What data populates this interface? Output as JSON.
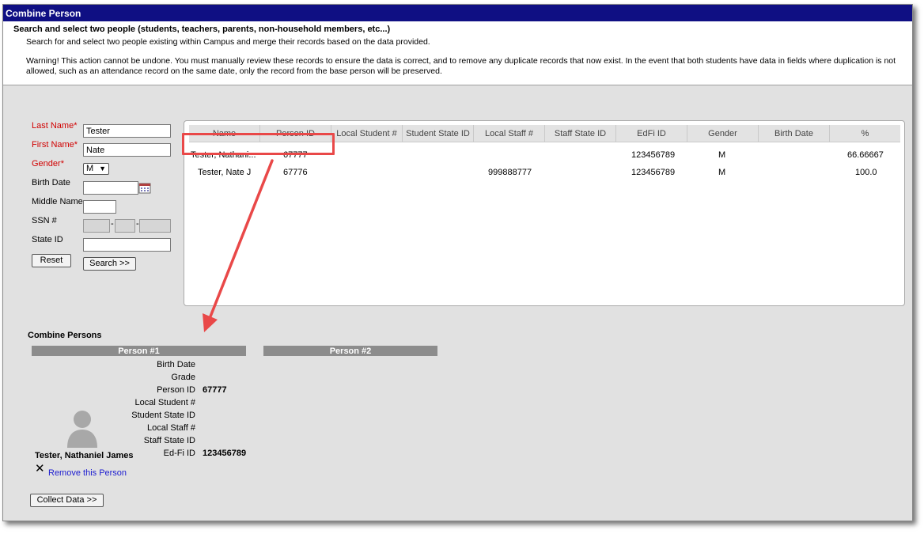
{
  "window": {
    "title": "Combine Person"
  },
  "header": {
    "title": "Search and select two people (students, teachers, parents, non-household members, etc...)",
    "description": "Search for and select two people existing within Campus and merge their records based on the data provided.",
    "warning": "Warning! This action cannot be undone. You must manually review these records to ensure the data is correct, and to remove any duplicate records that now exist. In the event that both students have data in fields where duplication is not allowed, such as an attendance record on the same date, only the record from the base person will be preserved."
  },
  "search": {
    "last_name_label": "Last Name*",
    "last_name_value": "Tester",
    "first_name_label": "First Name*",
    "first_name_value": "Nate",
    "gender_label": "Gender*",
    "gender_value": "M",
    "birth_date_label": "Birth Date",
    "middle_name_label": "Middle Name",
    "ssn_label": "SSN #",
    "ssn_sep": "-",
    "state_id_label": "State ID",
    "reset_label": "Reset",
    "search_label": "Search >>"
  },
  "results": {
    "columns": [
      "Name",
      "Person ID",
      "Local Student #",
      "Student State ID",
      "Local Staff #",
      "Staff State ID",
      "EdFi ID",
      "Gender",
      "Birth Date",
      "%"
    ],
    "rows": [
      {
        "name": "Tester, Nathani...",
        "person_id": "67777",
        "local_student": "",
        "student_state_id": "",
        "local_staff": "",
        "staff_state_id": "",
        "edfi_id": "123456789",
        "gender": "M",
        "birth_date": "",
        "pct": "66.66667"
      },
      {
        "name": "Tester, Nate J",
        "person_id": "67776",
        "local_student": "",
        "student_state_id": "",
        "local_staff": "999888777",
        "staff_state_id": "",
        "edfi_id": "123456789",
        "gender": "M",
        "birth_date": "",
        "pct": "100.0"
      }
    ]
  },
  "combine": {
    "section_title": "Combine Persons",
    "person1_header": "Person #1",
    "person2_header": "Person #2",
    "fields": [
      {
        "label": "Birth Date",
        "value": ""
      },
      {
        "label": "Grade",
        "value": ""
      },
      {
        "label": "Person ID",
        "value": "67777"
      },
      {
        "label": "Local Student #",
        "value": ""
      },
      {
        "label": "Student State ID",
        "value": ""
      },
      {
        "label": "Local Staff #",
        "value": ""
      },
      {
        "label": "Staff State ID",
        "value": ""
      },
      {
        "label": "Ed-Fi ID",
        "value": "123456789"
      }
    ],
    "person_name": "Tester, Nathaniel James",
    "remove_label": "Remove this Person",
    "collect_label": "Collect Data >>"
  },
  "colors": {
    "titlebar": "#0f0f83",
    "required_label": "#d10000",
    "annotation": "#e94848",
    "link": "#1c1cd0"
  },
  "icons": [
    "calendar-icon",
    "chevron-down-icon",
    "close-icon",
    "avatar-icon"
  ]
}
